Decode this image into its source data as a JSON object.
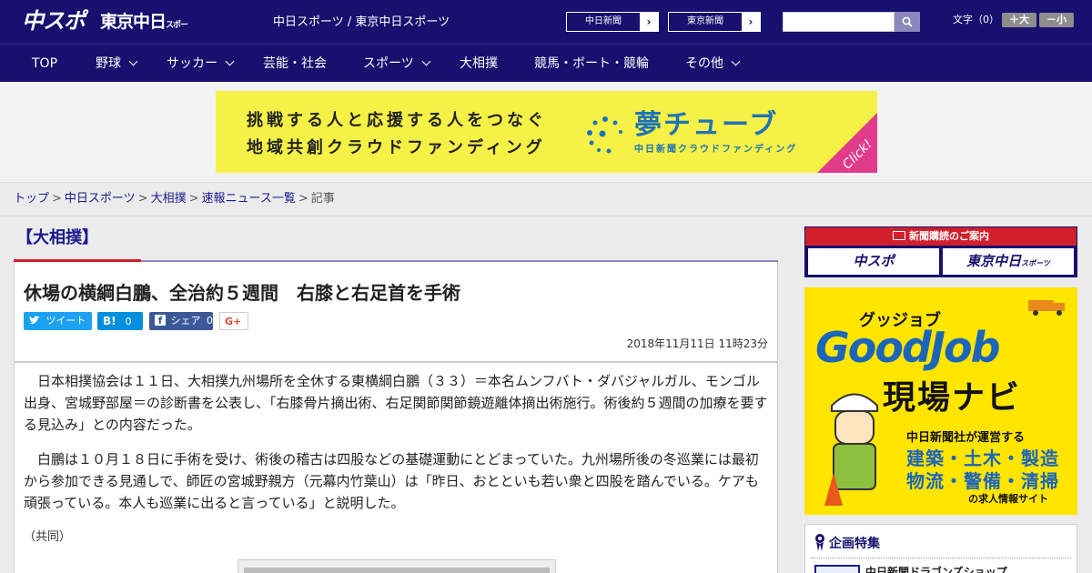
{
  "header": {
    "logo_chuspo": "中スポ",
    "logo_tokyo": "東京中日",
    "logo_tokyo_small": "スポーツ",
    "sites_text": "中日スポーツ / 東京中日スポーツ",
    "site_buttons": [
      {
        "label": "中日新聞",
        "arrow": "›"
      },
      {
        "label": "東京新聞",
        "arrow": "›"
      }
    ],
    "search_placeholder": "",
    "font_label": "文字（0）",
    "font_larger": "＋大",
    "font_smaller": "－小"
  },
  "nav": {
    "items": [
      {
        "label": "TOP"
      },
      {
        "label": "野球"
      },
      {
        "label": "サッカー"
      },
      {
        "label": "芸能・社会"
      },
      {
        "label": "スポーツ"
      },
      {
        "label": "大相撲"
      },
      {
        "label": "競馬・ボート・競輪"
      },
      {
        "label": "その他"
      }
    ]
  },
  "ad": {
    "line1": "挑戦する人と応援する人をつなぐ",
    "line2": "地域共創クラウドファンディング",
    "brand": "夢チューブ",
    "brand_sub": "中日新聞クラウドファンディング",
    "click": "Click!"
  },
  "breadcrumb": {
    "items": [
      "トップ",
      "中日スポーツ",
      "大相撲",
      "速報ニュース一覧"
    ],
    "current": "記事",
    "separator": ">"
  },
  "article": {
    "category": "【大相撲】",
    "title": "休場の横綱白鵬、全治約５週間　右膝と右足首を手術",
    "share": {
      "tweet": "ツイート",
      "hatena_label": "B!",
      "hatena_count": "0",
      "facebook_label": "シェア",
      "facebook_count": "0",
      "gplus": "G+"
    },
    "date": "2018年11月11日 11時23分",
    "paragraphs": [
      "日本相撲協会は１１日、大相撲九州場所を全休する東横綱白鵬（３３）＝本名ムンフバト・ダバジャルガル、モンゴル出身、宮城野部屋＝の診断書を公表し、「右膝骨片摘出術、右足関節関節鏡遊離体摘出術施行。術後約５週間の加療を要する見込み」との内容だった。",
      "白鵬は１０月１８日に手術を受け、術後の稽古は四股などの基礎運動にとどまっていた。九州場所後の冬巡業には最初から参加できる見通しで、師匠の宮城野親方（元幕内竹葉山）は「昨日、おとといも若い衆と四股を踏んでいる。ケアも頑張っている。本人も巡業に出ると言っている」と説明した。"
    ],
    "credit": "（共同）"
  },
  "sidebar": {
    "subscribe_head": "新聞購読のご案内",
    "subscribe_chuspo": "中スポ",
    "subscribe_tokyo": "東京中日",
    "subscribe_tokyo_small": "スポーツ",
    "gj_small": "グッジョブ",
    "gj_title": "GoodJob",
    "gj_navi": "現場ナビ",
    "gj_by": "中日新聞社が運営する",
    "gj_jobs1": "建築・土木・製造",
    "gj_jobs2": "物流・警備・清掃",
    "gj_site": "の求人情報サイト",
    "feature_title": "企画特集",
    "feature_item": "中日新聞ドラゴンズショップ"
  },
  "colors": {
    "brand_navy": "#180f6e",
    "accent_red": "#d0202c",
    "link": "#1a1a8c",
    "ad_yellow": "#f6f146",
    "ad_blue": "#1e73b7",
    "twitter": "#1da1f2",
    "hatena": "#008fde",
    "facebook": "#3b5998"
  }
}
